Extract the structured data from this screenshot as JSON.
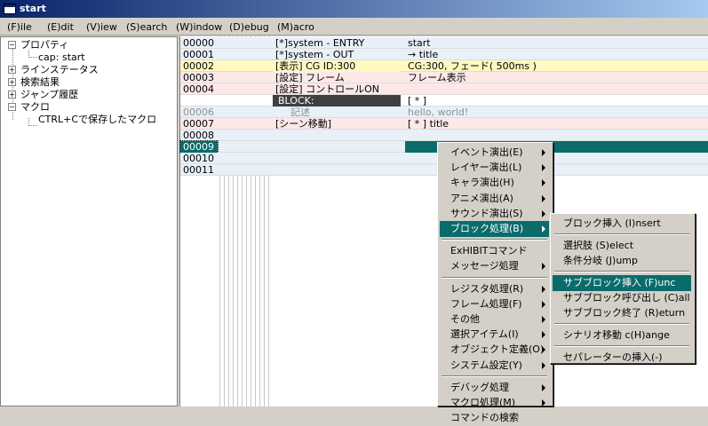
{
  "window": {
    "title": "start"
  },
  "menubar": [
    {
      "label": "(F)ile"
    },
    {
      "label": "(E)dit"
    },
    {
      "label": "(V)iew"
    },
    {
      "label": "(S)earch"
    },
    {
      "label": "(W)indow"
    },
    {
      "label": "(D)ebug"
    },
    {
      "label": "(M)acro"
    }
  ],
  "tree": {
    "nodes": [
      {
        "label": "プロパティ",
        "expander": "−"
      },
      {
        "label": "cap: start",
        "expander": ""
      },
      {
        "label": "ラインステータス",
        "expander": "+"
      },
      {
        "label": "検索結果",
        "expander": "+"
      },
      {
        "label": "ジャンプ履歴",
        "expander": "+"
      },
      {
        "label": "マクロ",
        "expander": "−"
      },
      {
        "label": "CTRL+Cで保存したマクロ",
        "expander": ""
      }
    ]
  },
  "grid": {
    "rows": [
      {
        "num": "00000",
        "cmd": "[*]system -  ENTRY",
        "arg": "start",
        "bg": "#e8f0f8",
        "color": "#000"
      },
      {
        "num": "00001",
        "cmd": "[*]system -  OUT",
        "arg": "→ title",
        "bg": "#e8f0f8",
        "color": "#000"
      },
      {
        "num": "00002",
        "cmd": "[表示] CG ID:300",
        "arg": "CG:300, フェード( 500ms )",
        "bg": "#fff8c0",
        "color": "#000"
      },
      {
        "num": "00003",
        "cmd": "[設定] フレーム",
        "arg": "フレーム表示",
        "bg": "#fde8e8",
        "color": "#000"
      },
      {
        "num": "00004",
        "cmd": "[設定] コントロールON",
        "arg": "",
        "bg": "#fde8e8",
        "color": "#000"
      },
      {
        "num": "",
        "cmd": "BLOCK:",
        "arg": "[ * ]",
        "bg": "#ffffff",
        "color": "#000",
        "block": true
      },
      {
        "num": "00006",
        "cmd": "記述",
        "arg": "hello, world!",
        "bg": "#e8f0f8",
        "color": "#909090"
      },
      {
        "num": "00007",
        "cmd": "[シーン移動]",
        "arg": "[ * ] title",
        "bg": "#fde8e8",
        "color": "#000"
      },
      {
        "num": "00008",
        "cmd": "",
        "arg": "",
        "bg": "#e8f0f8",
        "color": "#000"
      },
      {
        "num": "00009",
        "cmd": "",
        "arg": "",
        "bg": "#e8f0f8",
        "color": "#fff",
        "selected": true
      },
      {
        "num": "00010",
        "cmd": "",
        "arg": "",
        "bg": "#e8f0f8",
        "color": "#000"
      },
      {
        "num": "00011",
        "cmd": "",
        "arg": "",
        "bg": "#e8f0f8",
        "color": "#000"
      }
    ]
  },
  "context_menu": {
    "items": [
      {
        "label": "イベント演出(E)",
        "submenu": true
      },
      {
        "label": "レイヤー演出(L)",
        "submenu": true
      },
      {
        "label": "キャラ演出(H)",
        "submenu": true
      },
      {
        "label": "アニメ演出(A)",
        "submenu": true
      },
      {
        "label": "サウンド演出(S)",
        "submenu": true
      },
      {
        "label": "ブロック処理(B)",
        "submenu": true,
        "selected": true
      },
      {
        "sep": true
      },
      {
        "label": "ExHIBITコマンド",
        "submenu": false
      },
      {
        "label": "メッセージ処理",
        "submenu": true
      },
      {
        "sep": true
      },
      {
        "label": "レジスタ処理(R)",
        "submenu": true
      },
      {
        "label": "フレーム処理(F)",
        "submenu": true
      },
      {
        "label": "その他",
        "submenu": true
      },
      {
        "label": "選択アイテム(I)",
        "submenu": true
      },
      {
        "label": "オブジェクト定義(O)",
        "submenu": true
      },
      {
        "label": "システム設定(Y)",
        "submenu": true
      },
      {
        "sep": true
      },
      {
        "label": "デバッグ処理",
        "submenu": true
      },
      {
        "label": "マクロ処理(M)",
        "submenu": true
      },
      {
        "label": "コマンドの検索",
        "submenu": false
      }
    ]
  },
  "submenu": {
    "items": [
      {
        "label": "ブロック挿入 (I)nsert"
      },
      {
        "sep": true
      },
      {
        "label": "選択肢 (S)elect"
      },
      {
        "label": "条件分岐 (J)ump"
      },
      {
        "sep": true
      },
      {
        "label": "サブブロック挿入 (F)unc",
        "selected": true
      },
      {
        "label": "サブブロック呼び出し (C)all"
      },
      {
        "label": "サブブロック終了 (R)eturn"
      },
      {
        "sep": true
      },
      {
        "label": "シナリオ移動 c(H)ange"
      },
      {
        "sep": true
      },
      {
        "label": "セパレーターの挿入(-)"
      }
    ]
  },
  "colors": {
    "selection": "#0a6b6b",
    "block_bar": "#404040"
  }
}
